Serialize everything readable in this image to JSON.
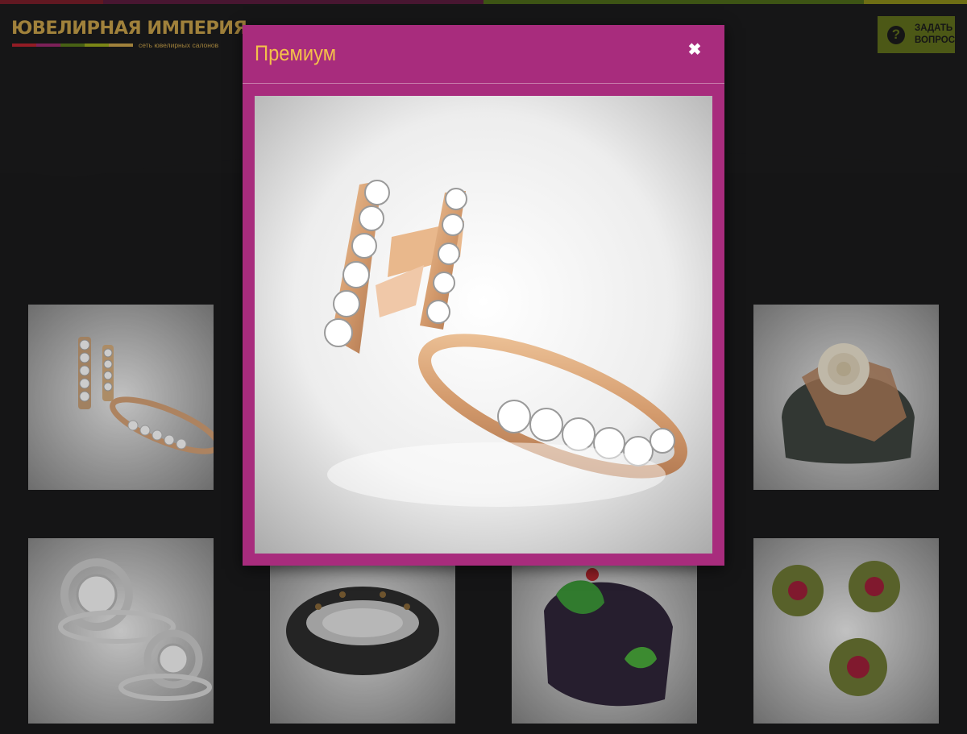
{
  "brand": {
    "name": "ЮВЕЛИРНАЯ ИМПЕРИЯ",
    "tagline": "сеть ювелирных салонов",
    "stripe_colors": [
      "#b8232f",
      "#9b2a6f",
      "#5a7a1a",
      "#9aa81c",
      "#c9a24a"
    ]
  },
  "colors": {
    "background": "#1b1b1c",
    "modal": "#a82c7d",
    "modal_title": "#f4c04a",
    "ask_button": "#5f6e1c"
  },
  "header": {
    "ask_button": {
      "line1": "ЗАДАТЬ",
      "line2": "ВОПРОС",
      "icon": "question-circle-icon"
    }
  },
  "gallery": {
    "items": [
      {
        "subject": "earrings-and-ring-rose-gold"
      },
      {
        "subject": "ivory-rose-cuff"
      },
      {
        "subject": "halo-diamond-rings"
      },
      {
        "subject": "stingray-bangle"
      },
      {
        "subject": "frog-cuff"
      },
      {
        "subject": "tourmaline-flower-set"
      }
    ]
  },
  "modal": {
    "title": "Премиум",
    "close_icon": "close-icon",
    "image_subject": "earrings-and-ring-rose-gold"
  }
}
